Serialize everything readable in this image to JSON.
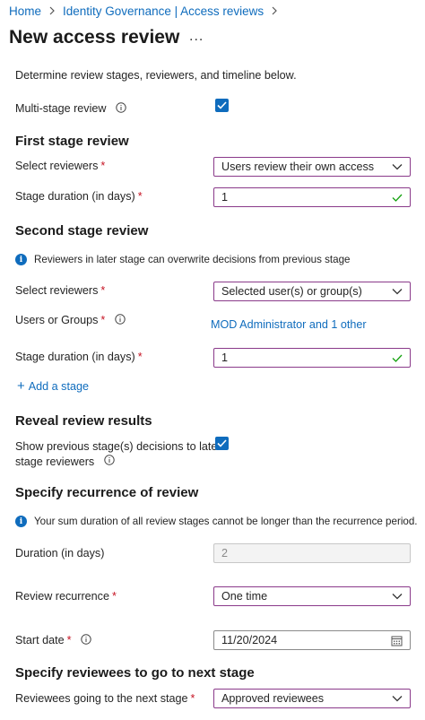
{
  "breadcrumb": {
    "home": "Home",
    "parent": "Identity Governance | Access reviews"
  },
  "page": {
    "title": "New access review",
    "more": "..."
  },
  "intro": "Determine review stages, reviewers, and timeline below.",
  "multi_stage": {
    "label": "Multi-stage review",
    "checked": true
  },
  "first_stage": {
    "heading": "First stage review",
    "reviewers_label": "Select reviewers",
    "reviewers_value": "Users review their own access",
    "duration_label": "Stage duration (in days)",
    "duration_value": "1"
  },
  "second_stage": {
    "heading": "Second stage review",
    "notice": "Reviewers in later stage can overwrite decisions from previous stage",
    "reviewers_label": "Select reviewers",
    "reviewers_value": "Selected user(s) or group(s)",
    "users_label": "Users or Groups",
    "users_link": "MOD Administrator and 1 other",
    "duration_label": "Stage duration (in days)",
    "duration_value": "1"
  },
  "add_stage": {
    "icon": "+",
    "label": "Add a stage"
  },
  "reveal": {
    "heading": "Reveal review results",
    "label_line1": "Show previous stage(s) decisions to later",
    "label_line2": "stage reviewers",
    "checked": true
  },
  "recurrence": {
    "heading": "Specify recurrence of review",
    "notice": "Your sum duration of all review stages cannot be longer than the recurrence period.",
    "duration_label": "Duration (in days)",
    "duration_value": "2",
    "recurrence_label": "Review recurrence",
    "recurrence_value": "One time",
    "start_label": "Start date",
    "start_value": "11/20/2024"
  },
  "next_stage": {
    "heading": "Specify reviewees to go to next stage",
    "label": "Reviewees going to the next stage",
    "value": "Approved reviewees"
  },
  "required_marker": "*",
  "colors": {
    "accent": "#0f6cbd",
    "focus_border": "#8a3a8a",
    "required": "#c50f1f",
    "valid": "#13a10e"
  }
}
